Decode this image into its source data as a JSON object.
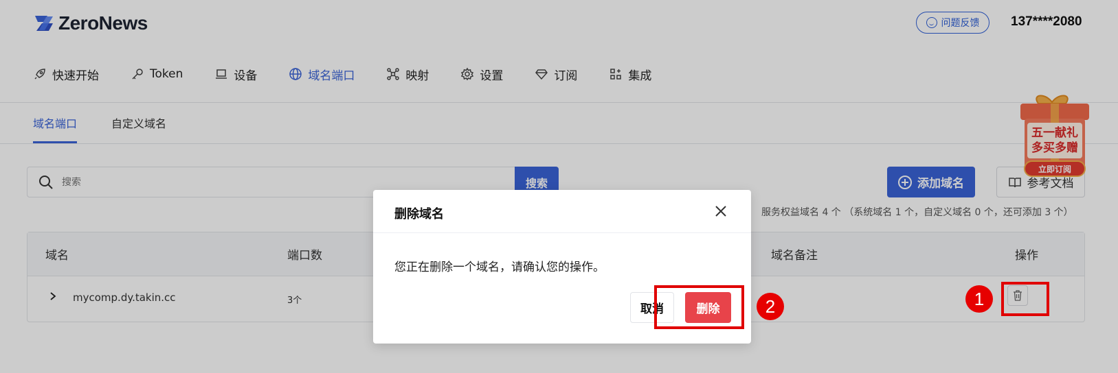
{
  "app": {
    "logo_text": "ZeroNews"
  },
  "header": {
    "feedback_label": "问题反馈",
    "user": "137****2080"
  },
  "nav": [
    {
      "label": "快速开始",
      "icon": "rocket-icon",
      "active": false
    },
    {
      "label": "Token",
      "icon": "key-icon",
      "active": false
    },
    {
      "label": "设备",
      "icon": "laptop-icon",
      "active": false
    },
    {
      "label": "域名端口",
      "icon": "globe-icon",
      "active": true
    },
    {
      "label": "映射",
      "icon": "network-icon",
      "active": false
    },
    {
      "label": "设置",
      "icon": "gear-icon",
      "active": false
    },
    {
      "label": "订阅",
      "icon": "diamond-icon",
      "active": false
    },
    {
      "label": "集成",
      "icon": "apps-icon",
      "active": false
    }
  ],
  "tabs": [
    {
      "label": "域名端口",
      "active": true
    },
    {
      "label": "自定义域名",
      "active": false
    }
  ],
  "search": {
    "placeholder": "搜索",
    "button_label": "搜索"
  },
  "actions": {
    "add_label": "添加域名",
    "doc_label": "参考文档"
  },
  "quota_text": "服务权益域名 4 个 （系统域名 1 个，自定义域名 0 个，还可添加 3 个）",
  "table": {
    "headers": {
      "domain": "域名",
      "ports": "端口数",
      "remark": "域名备注",
      "actions": "操作"
    },
    "rows": [
      {
        "domain": "mycomp.dy.takin.cc",
        "ports": "3个",
        "remark": ""
      }
    ]
  },
  "modal": {
    "title": "删除域名",
    "message": "您正在删除一个域名，请确认您的操作。",
    "cancel_label": "取消",
    "confirm_label": "删除"
  },
  "annotations": {
    "step1": "1",
    "step2": "2"
  },
  "promo": {
    "line1": "五一献礼",
    "line2": "多买多赠",
    "cta": "立即订阅"
  },
  "colors": {
    "primary": "#3a63d8",
    "danger": "#e8434a",
    "highlight": "#e00000"
  }
}
